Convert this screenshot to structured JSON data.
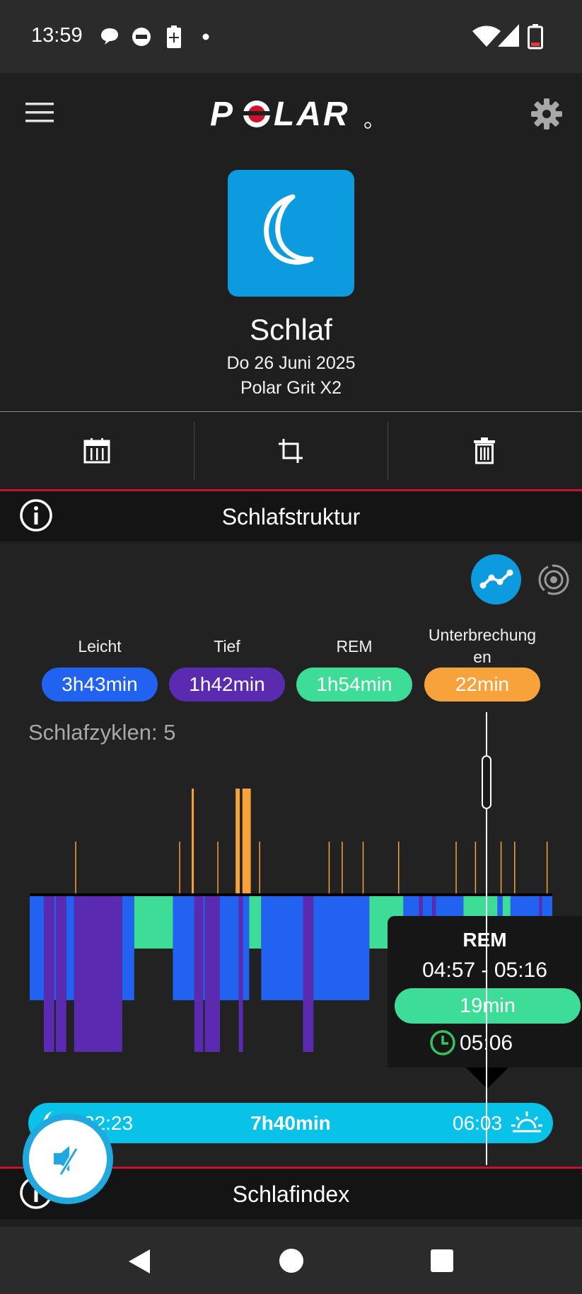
{
  "status_bar": {
    "time": "13:59",
    "icons": [
      "chat-bubble-icon",
      "do-not-disturb-icon",
      "battery-saver-icon",
      "dot-icon",
      "wifi-icon",
      "cell-signal-icon",
      "battery-icon"
    ]
  },
  "app_bar": {
    "menu_icon": "hamburger-menu-icon",
    "brand": "POLAR",
    "brand_accent": "#d3102b",
    "settings_icon": "gear-icon"
  },
  "session": {
    "icon": "moon-icon",
    "tile_color": "#0d9be0",
    "title": "Schlaf",
    "date": "Do 26 Juni 2025",
    "device": "Polar Grit X2"
  },
  "actions": [
    {
      "name": "calendar",
      "icon": "calendar-icon"
    },
    {
      "name": "crop",
      "icon": "crop-icon"
    },
    {
      "name": "delete",
      "icon": "trash-icon"
    }
  ],
  "sections": {
    "structure": "Schlafstruktur",
    "index": "Schlafindex"
  },
  "view_toggle": {
    "active": "graph-view-icon",
    "inactive": "radial-view-icon"
  },
  "stages": [
    {
      "label": "Leicht",
      "value": "3h43min",
      "color": "#2262f0"
    },
    {
      "label": "Tief",
      "value": "1h42min",
      "color": "#5a2bb0"
    },
    {
      "label": "REM",
      "value": "1h54min",
      "color": "#3ddc97"
    },
    {
      "label": "Unterbrechung\nen",
      "value": "22min",
      "color": "#f7a23b"
    }
  ],
  "cycles": "Schlafzyklen: 5",
  "chart_data": {
    "type": "hypnogram",
    "stage_levels": [
      "REM",
      "Leicht",
      "Tief"
    ],
    "stage_colors": {
      "REM": "#3ddc97",
      "Leicht": "#2262f0",
      "Tief": "#5a2bb0",
      "Unterbrechung": "#f7a23b"
    },
    "segments": [
      {
        "stage": "Leicht",
        "start": 0.0,
        "end": 0.027
      },
      {
        "stage": "Tief",
        "start": 0.027,
        "end": 0.047
      },
      {
        "stage": "Leicht",
        "start": 0.047,
        "end": 0.05
      },
      {
        "stage": "Tief",
        "start": 0.05,
        "end": 0.07
      },
      {
        "stage": "Leicht",
        "start": 0.07,
        "end": 0.085
      },
      {
        "stage": "Tief",
        "start": 0.085,
        "end": 0.177
      },
      {
        "stage": "Leicht",
        "start": 0.177,
        "end": 0.2
      },
      {
        "stage": "REM",
        "start": 0.2,
        "end": 0.274
      },
      {
        "stage": "Leicht",
        "start": 0.274,
        "end": 0.315
      },
      {
        "stage": "Tief",
        "start": 0.315,
        "end": 0.332
      },
      {
        "stage": "Leicht",
        "start": 0.332,
        "end": 0.335
      },
      {
        "stage": "Tief",
        "start": 0.335,
        "end": 0.364
      },
      {
        "stage": "Leicht",
        "start": 0.364,
        "end": 0.4
      },
      {
        "stage": "Tief",
        "start": 0.4,
        "end": 0.408
      },
      {
        "stage": "Leicht",
        "start": 0.408,
        "end": 0.42
      },
      {
        "stage": "REM",
        "start": 0.42,
        "end": 0.443
      },
      {
        "stage": "Leicht",
        "start": 0.443,
        "end": 0.523
      },
      {
        "stage": "Tief",
        "start": 0.523,
        "end": 0.543
      },
      {
        "stage": "Leicht",
        "start": 0.543,
        "end": 0.65
      },
      {
        "stage": "REM",
        "start": 0.65,
        "end": 0.715
      },
      {
        "stage": "Leicht",
        "start": 0.715,
        "end": 0.745
      },
      {
        "stage": "Tief",
        "start": 0.745,
        "end": 0.752
      },
      {
        "stage": "Leicht",
        "start": 0.752,
        "end": 0.77
      },
      {
        "stage": "Tief",
        "start": 0.77,
        "end": 0.777
      },
      {
        "stage": "Leicht",
        "start": 0.777,
        "end": 0.83
      },
      {
        "stage": "REM",
        "start": 0.83,
        "end": 0.895
      },
      {
        "stage": "Leicht",
        "start": 0.895,
        "end": 0.905
      },
      {
        "stage": "REM",
        "start": 0.905,
        "end": 0.92
      },
      {
        "stage": "Leicht",
        "start": 0.92,
        "end": 0.975
      },
      {
        "stage": "Tief",
        "start": 0.975,
        "end": 0.98
      },
      {
        "stage": "Leicht",
        "start": 0.98,
        "end": 1.0
      }
    ],
    "interruptions": [
      {
        "at": 0.088,
        "strength": 0.5
      },
      {
        "at": 0.287,
        "strength": 0.5
      },
      {
        "at": 0.312,
        "strength": 1.0
      },
      {
        "at": 0.36,
        "strength": 0.5
      },
      {
        "at": 0.398,
        "strength": 1.0,
        "width": 0.008
      },
      {
        "at": 0.415,
        "strength": 1.0,
        "width": 0.016
      },
      {
        "at": 0.44,
        "strength": 0.5
      },
      {
        "at": 0.573,
        "strength": 0.5
      },
      {
        "at": 0.598,
        "strength": 0.5
      },
      {
        "at": 0.638,
        "strength": 0.5
      },
      {
        "at": 0.706,
        "strength": 0.5
      },
      {
        "at": 0.816,
        "strength": 0.5
      },
      {
        "at": 0.853,
        "strength": 0.5
      },
      {
        "at": 0.902,
        "strength": 0.5
      },
      {
        "at": 0.928,
        "strength": 0.5
      },
      {
        "at": 0.99,
        "strength": 0.5
      }
    ],
    "cursor_at": 0.874
  },
  "tooltip": {
    "stage": "REM",
    "range": "04:57 - 05:16",
    "duration": "19min",
    "time": "05:06",
    "clock_icon": "clock-icon"
  },
  "timeline": {
    "start": "22:23",
    "start_icon": "moon-icon",
    "total": "7h40min",
    "end": "06:03",
    "end_icon": "sunrise-icon"
  },
  "fab": {
    "icon": "mute-icon"
  },
  "nav": [
    "back-icon",
    "home-icon",
    "recents-icon"
  ]
}
